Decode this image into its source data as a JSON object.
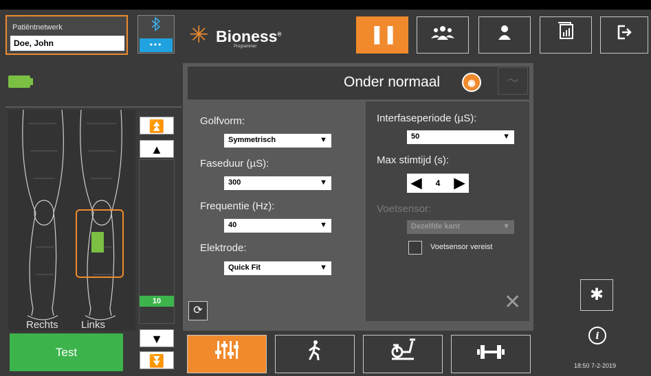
{
  "patient": {
    "network_label": "Patiëntnetwerk",
    "name": "Doe, John"
  },
  "bluetooth": {
    "icon": "bluetooth-icon",
    "dots": "•••"
  },
  "battery": {
    "icon": "battery-icon",
    "color": "#7bc043"
  },
  "legs": {
    "right_label": "Rechts",
    "left_label": "Links"
  },
  "test_button": "Test",
  "intensity": {
    "value": "10",
    "up_fast": "⏫",
    "up": "▲",
    "down": "▼",
    "down_fast": "⏬"
  },
  "brand": {
    "name": "Bioness",
    "sub": "Programmer",
    "mark": "®"
  },
  "nav": [
    {
      "name": "legs-icon",
      "glyph": "❚❚"
    },
    {
      "name": "group-icon",
      "glyph": "👥"
    },
    {
      "name": "person-icon",
      "glyph": "👤"
    },
    {
      "name": "report-icon",
      "glyph": "▥"
    },
    {
      "name": "exit-icon",
      "glyph": "⇥"
    }
  ],
  "panel": {
    "title": "Onder normaal",
    "title_icon": "◉",
    "wave_icon": "〜"
  },
  "form": {
    "golfvorm": {
      "label": "Golfvorm:",
      "value": "Symmetrisch"
    },
    "faseduur": {
      "label": "Faseduur (µS):",
      "value": "300"
    },
    "frequentie": {
      "label": "Frequentie (Hz):",
      "value": "40"
    },
    "elektrode": {
      "label": "Elektrode:",
      "value": "Quick Fit"
    },
    "interfase": {
      "label": "Interfaseperiode (µS):",
      "value": "50"
    },
    "max_stim": {
      "label": "Max stimtijd (s):",
      "value": "4",
      "left": "◀",
      "right": "▶"
    },
    "voetsensor": {
      "label": "Voetsensor:",
      "value": "Dezelfde kant"
    },
    "voetsensor_required": {
      "label": "Voetsensor vereist"
    }
  },
  "close_glyph": "✕",
  "refresh_glyph": "⟳",
  "settings_glyph": "✱",
  "info_glyph": "i",
  "clock": "18:50 7-2-2019",
  "bottom_tabs": [
    {
      "name": "sliders-icon",
      "glyph": "⫶⫶⫶"
    },
    {
      "name": "walking-icon",
      "glyph": "🚶"
    },
    {
      "name": "bike-icon",
      "glyph": "🚲"
    },
    {
      "name": "dumbbell-icon",
      "glyph": "⊣⊢"
    }
  ],
  "colors": {
    "accent": "#f08a2c",
    "green": "#3cb44b",
    "blue": "#21a2e0"
  }
}
